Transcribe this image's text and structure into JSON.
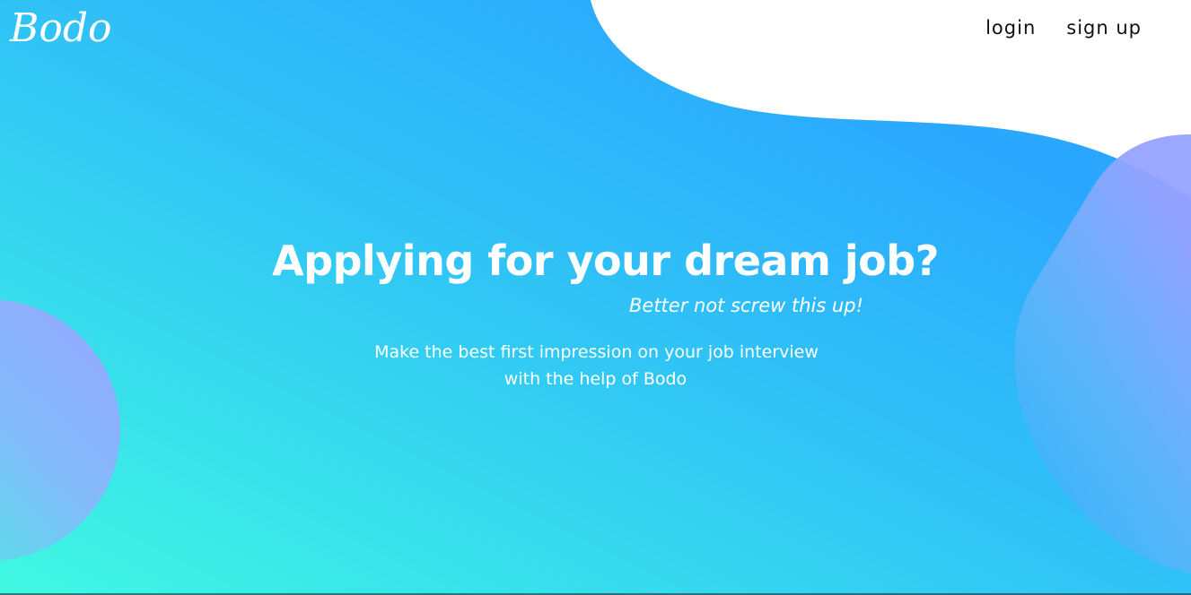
{
  "brand": {
    "logo_text": "Bodo"
  },
  "nav": {
    "login_label": "login",
    "signup_label": "sign up"
  },
  "hero": {
    "headline": "Applying for your dream job?",
    "tagline": "Better not screw this up!",
    "subtext_line1": "Make the best first impression on your job interview",
    "subtext_line2": "with the help of Bodo"
  },
  "colors": {
    "gradient_start": "#3ff8e4",
    "gradient_mid": "#2dc2f7",
    "gradient_end": "#2aa6ff",
    "blob_purple": "#97a3ff",
    "text_light": "#ffffff",
    "text_dark": "#111111"
  }
}
